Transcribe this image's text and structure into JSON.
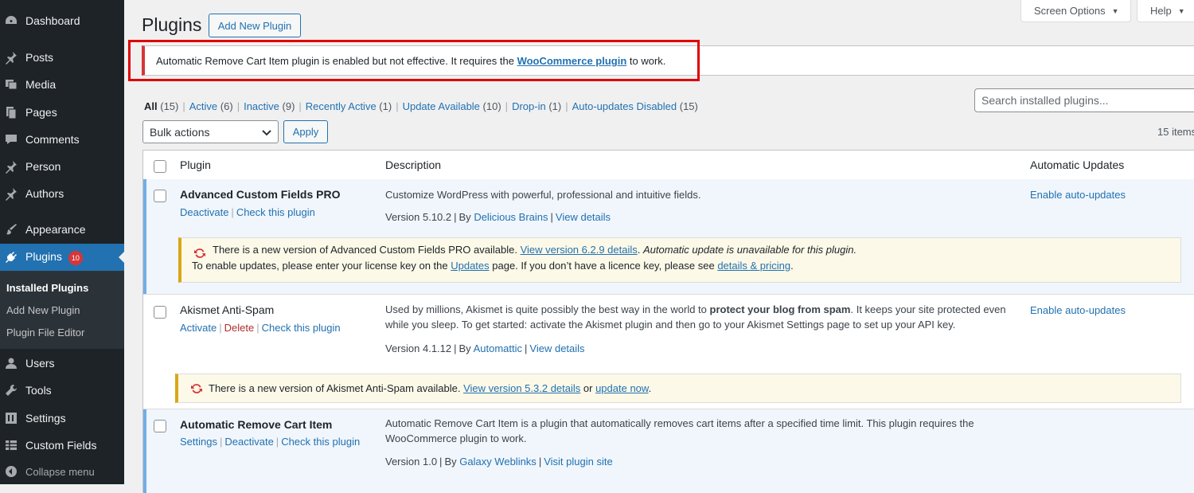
{
  "sidebar": {
    "items": [
      {
        "label": "Dashboard",
        "icon": "dashboard-icon"
      },
      {
        "label": "Posts",
        "icon": "pin-icon"
      },
      {
        "label": "Media",
        "icon": "media-icon"
      },
      {
        "label": "Pages",
        "icon": "pages-icon"
      },
      {
        "label": "Comments",
        "icon": "comments-icon"
      },
      {
        "label": "Person",
        "icon": "pin-icon"
      },
      {
        "label": "Authors",
        "icon": "pin-icon"
      },
      {
        "label": "Appearance",
        "icon": "brush-icon"
      },
      {
        "label": "Plugins",
        "icon": "plugin-icon",
        "badge": "10"
      },
      {
        "label": "Users",
        "icon": "users-icon"
      },
      {
        "label": "Tools",
        "icon": "wrench-icon"
      },
      {
        "label": "Settings",
        "icon": "settings-icon"
      },
      {
        "label": "Custom Fields",
        "icon": "table-icon"
      }
    ],
    "submenu": [
      "Installed Plugins",
      "Add New Plugin",
      "Plugin File Editor"
    ],
    "collapse_label": "Collapse menu"
  },
  "top_tabs": {
    "screen_options": "Screen Options",
    "help": "Help"
  },
  "header": {
    "title": "Plugins",
    "add_new": "Add New Plugin"
  },
  "notice": {
    "text_before": "Automatic Remove Cart Item plugin is enabled but not effective. It requires the ",
    "link": "WooCommerce plugin",
    "text_after": " to work."
  },
  "filters": [
    {
      "label": "All",
      "count": "(15)"
    },
    {
      "label": "Active",
      "count": "(6)"
    },
    {
      "label": "Inactive",
      "count": "(9)"
    },
    {
      "label": "Recently Active",
      "count": "(1)"
    },
    {
      "label": "Update Available",
      "count": "(10)"
    },
    {
      "label": "Drop-in",
      "count": "(1)"
    },
    {
      "label": "Auto-updates Disabled",
      "count": "(15)"
    }
  ],
  "search": {
    "placeholder": "Search installed plugins..."
  },
  "bulk": {
    "selected": "Bulk actions",
    "apply": "Apply"
  },
  "items_count": "15 items",
  "table": {
    "headers": {
      "plugin": "Plugin",
      "description": "Description",
      "auto_updates": "Automatic Updates"
    },
    "rows": [
      {
        "name": "Advanced Custom Fields PRO",
        "actions": [
          "Deactivate",
          "Check this plugin"
        ],
        "description": "Customize WordPress with powerful, professional and intuitive fields.",
        "version": "Version 5.10.2",
        "by": "By",
        "author": "Delicious Brains",
        "details": "View details",
        "auto": "Enable auto-updates",
        "update": {
          "text1": "There is a new version of Advanced Custom Fields PRO available. ",
          "link1": "View version 6.2.9 details",
          "text2": ". ",
          "em": "Automatic update is unavailable for this plugin.",
          "line2_before": "To enable updates, please enter your license key on the ",
          "link2": "Updates",
          "line2_mid": " page. If you don’t have a licence key, please see ",
          "link3": "details & pricing",
          "line2_end": "."
        }
      },
      {
        "name": "Akismet Anti-Spam",
        "actions": [
          "Activate",
          "Delete",
          "Check this plugin"
        ],
        "description_before": "Used by millions, Akismet is quite possibly the best way in the world to ",
        "description_bold": "protect your blog from spam",
        "description_after": ". It keeps your site protected even while you sleep. To get started: activate the Akismet plugin and then go to your Akismet Settings page to set up your API key.",
        "version": "Version 4.1.12",
        "by": "By",
        "author": "Automattic",
        "details": "View details",
        "auto": "Enable auto-updates",
        "update": {
          "text1": "There is a new version of Akismet Anti-Spam available. ",
          "link1": "View version 5.3.2 details",
          "or": " or ",
          "link2": "update now",
          "end": "."
        }
      },
      {
        "name": "Automatic Remove Cart Item",
        "actions": [
          "Settings",
          "Deactivate",
          "Check this plugin"
        ],
        "description": "Automatic Remove Cart Item is a plugin that automatically removes cart items after a specified time limit. This plugin requires the WooCommerce plugin to work.",
        "version": "Version 1.0",
        "by": "By",
        "author": "Galaxy Weblinks",
        "details": "Visit plugin site"
      }
    ]
  }
}
